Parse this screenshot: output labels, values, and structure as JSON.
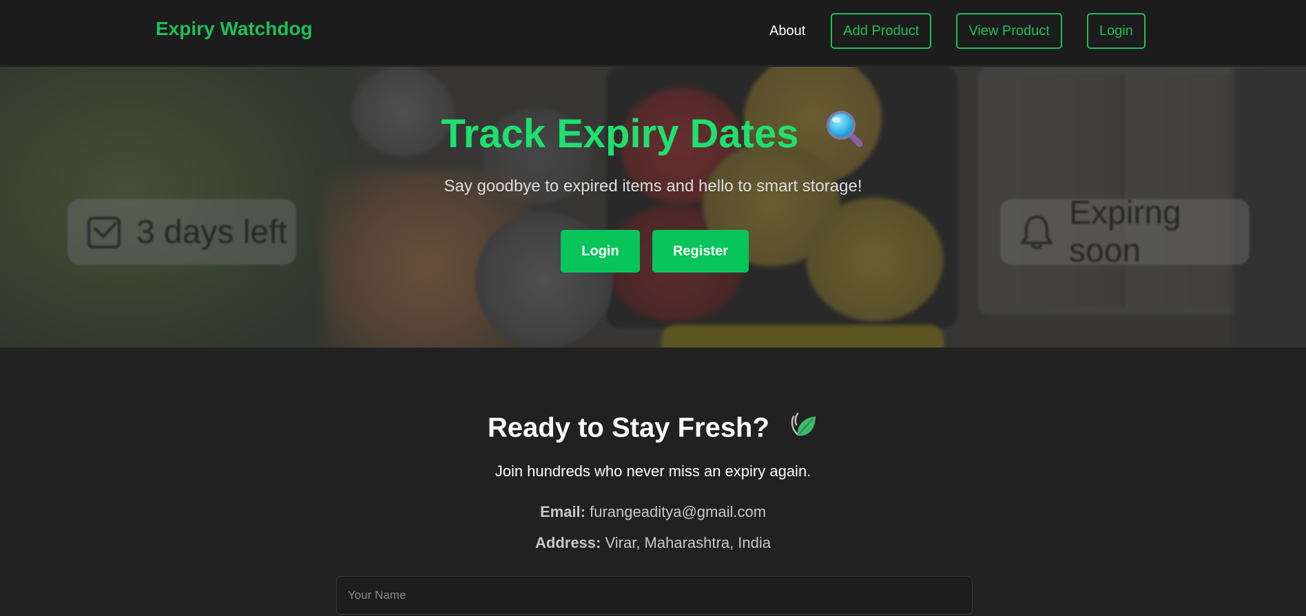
{
  "nav": {
    "brand": "Expiry Watchdog",
    "about": "About",
    "add_product": "Add Product",
    "view_product": "View Product",
    "login": "Login"
  },
  "hero": {
    "title": "Track Expiry Dates",
    "title_icon": "magnifying-glass-icon",
    "subtitle": "Say goodbye to expired items and hello to smart storage!",
    "login_button": "Login",
    "register_button": "Register",
    "background_tags": {
      "left": "3 days left",
      "left_icon": "calendar-check-icon",
      "right": "Expirng soon",
      "right_icon": "bell-icon"
    }
  },
  "contact": {
    "title": "Ready to Stay Fresh?",
    "title_icon": "leaf-icon",
    "subtitle": "Join hundreds who never miss an expiry again.",
    "email_label": "Email:",
    "email_value": "furangeaditya@gmail.com",
    "address_label": "Address:",
    "address_value": "Virar, Maharashtra, India",
    "name_placeholder": "Your Name"
  },
  "colors": {
    "accent": "#1fbf5a",
    "hero_title": "#1ee06e",
    "button_fill": "#07c55a",
    "page_bg": "#212121",
    "nav_bg": "#1c1c1c"
  }
}
